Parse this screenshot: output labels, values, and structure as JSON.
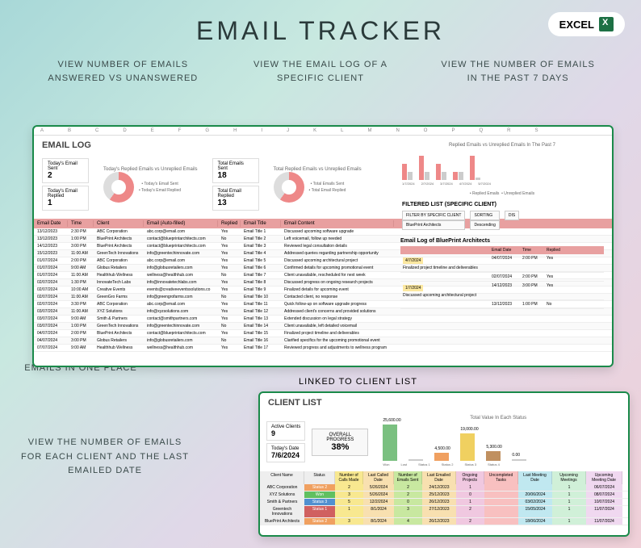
{
  "title": "EMAIL TRACKER",
  "excelBadge": "EXCEL",
  "callouts": {
    "top1": "VIEW NUMBER OF EMAILS ANSWERED VS UNANSWERED",
    "top2": "VIEW THE EMAIL LOG OF A SPECIFIC CLIENT",
    "top3": "VIEW THE NUMBER OF EMAILS IN THE PAST 7 DAYS",
    "left1": "RECORD ALL YOUR EMAILS IN ONE PLACE",
    "left2": "VIEW THE NUMBER OF EMAILS FOR EACH CLIENT AND THE LAST EMAILED DATE",
    "link": "LINKED TO CLIENT LIST"
  },
  "panel1": {
    "title": "EMAIL LOG",
    "stats": {
      "s1l": "Today's Email Sent",
      "s1v": "2",
      "s2l": "Today's Email Replied",
      "s2v": "1",
      "s3l": "Total Emails Sent",
      "s3v": "18",
      "s4l": "Total Email Replied",
      "s4v": "13"
    },
    "legend1a": "• Today's Email Sent",
    "legend1b": "• Today's Email Replied",
    "legend2a": "• Total Emails Sent",
    "legend2b": "• Total Email Replied",
    "chartTitle1": "Today's Replied Emails vs Unreplied Emails",
    "chartTitle2": "Total Replied Emails vs Unreplied Emails",
    "headers": [
      "Email Date",
      "Time",
      "Client",
      "Email (Auto-filled)",
      "Replied",
      "Email Title",
      "Email Content"
    ],
    "rows": [
      [
        "13/12/2023",
        "2:30 PM",
        "ABC Corporation",
        "abc.corp@email.com",
        "Yes",
        "Email Title 1",
        "Discussed upcoming software upgrade"
      ],
      [
        "13/12/2023",
        "1:00 PM",
        "BluePrint Architects",
        "contact@blueprintarchitects.com",
        "No",
        "Email Title 2",
        "Left voicemail, follow up needed"
      ],
      [
        "14/12/2023",
        "3:00 PM",
        "BluePrint Architects",
        "contact@blueprintarchitects.com",
        "Yes",
        "Email Title 3",
        "Reviewed legal consultation details"
      ],
      [
        "15/12/2023",
        "11:00 AM",
        "GreenTech Innovations",
        "info@greentechinnovate.com",
        "Yes",
        "Email Title 4",
        "Addressed queries regarding partnership opportunity"
      ],
      [
        "01/07/2024",
        "2:00 PM",
        "ABC Corporation",
        "abc.corp@email.com",
        "Yes",
        "Email Title 5",
        "Discussed upcoming architectural project"
      ],
      [
        "01/07/2024",
        "9:00 AM",
        "Globus Retailers",
        "info@globusretailers.com",
        "Yes",
        "Email Title 6",
        "Confirmed details for upcoming promotional event"
      ],
      [
        "01/07/2024",
        "11:00 AM",
        "Healthhub Wellness",
        "wellness@healthhub.com",
        "No",
        "Email Title 7",
        "Client unavailable, rescheduled for next week"
      ],
      [
        "02/07/2024",
        "1:30 PM",
        "InnovateTech Labs",
        "info@innovatetechlabs.com",
        "Yes",
        "Email Title 8",
        "Discussed progress on ongoing research projects"
      ],
      [
        "02/07/2024",
        "10:00 AM",
        "Creative Events",
        "events@creativeeventssolutions.co",
        "Yes",
        "Email Title 9",
        "Finalized details for upcoming event"
      ],
      [
        "02/07/2024",
        "11:00 AM",
        "GreenGro Farms",
        "info@greengrofarms.com",
        "No",
        "Email Title 10",
        "Contacted client, no response"
      ],
      [
        "02/07/2024",
        "3:30 PM",
        "ABC Corporation",
        "abc.corp@email.com",
        "Yes",
        "Email Title 11",
        "Quick follow-up on software upgrade progress"
      ],
      [
        "03/07/2024",
        "11:00 AM",
        "XYZ Solutions",
        "info@xyzsolutions.com",
        "Yes",
        "Email Title 12",
        "Addressed client's concerns and provided solutions"
      ],
      [
        "03/07/2024",
        "9:00 AM",
        "Smith & Partners",
        "contact@smithpartners.com",
        "Yes",
        "Email Title 13",
        "Extended discussion on legal strategy"
      ],
      [
        "03/07/2024",
        "1:00 PM",
        "GreenTech Innovations",
        "info@greentechinnovate.com",
        "No",
        "Email Title 14",
        "Client unavailable, left detailed voicemail"
      ],
      [
        "04/07/2024",
        "2:00 PM",
        "BluePrint Architects",
        "contact@blueprintarchitects.com",
        "Yes",
        "Email Title 15",
        "Finalized project timeline and deliverables"
      ],
      [
        "04/07/2024",
        "3:00 PM",
        "Globus Retailers",
        "info@globusretailers.com",
        "No",
        "Email Title 16",
        "Clarified specifics for the upcoming promotional event"
      ],
      [
        "07/07/2024",
        "9:00 AM",
        "Healthhub Wellness",
        "wellness@healthhub.com",
        "Yes",
        "Email Title 17",
        "Reviewed progress and adjustments to wellness program"
      ]
    ]
  },
  "rightChart": {
    "title": "Replied Emails vs Unreplied Emails In The Past 7",
    "legend1": "• Replied Emails",
    "legend2": "• Unreplied Emails",
    "dates": [
      "1/7/2024",
      "2/7/2024",
      "3/7/2024",
      "4/7/2024",
      "5/7/2024"
    ]
  },
  "filtered": {
    "title": "FILTERED LIST (SPECIFIC CLIENT)",
    "f1l": "FILTER BY SPECIFIC CLIENT",
    "f1v": "BluePrint Architects",
    "f2l": "SORTING",
    "f2v": "Descending",
    "f3l": "DIS",
    "logTitle": "Email Log of BluePrint Architects",
    "headers": [
      "",
      "Email Date",
      "Time",
      "Replied"
    ],
    "d1": "4/7/2024",
    "d2": "1/7/2024",
    "r1desc": "Finalized project timeline and deliverables",
    "r2desc": "Discussed upcoming architectural project",
    "rows": [
      [
        "04/07/2024",
        "2:00 PM",
        "Yes"
      ],
      [
        "02/07/2024",
        "2:00 PM",
        "Yes"
      ],
      [
        "14/12/2023",
        "3:00 PM",
        "Yes"
      ],
      [
        "13/12/2023",
        "1:00 PM",
        "No"
      ]
    ]
  },
  "panel2": {
    "title": "CLIENT LIST",
    "s1l": "Active Clients",
    "s1v": "9",
    "s2l": "Today's Date",
    "s2v": "7/6/2024",
    "pl": "OVERALL PROGRESS",
    "pv": "38%",
    "chartTitle": "Total Value In Each Status",
    "headers": [
      "Client Name",
      "Status",
      "Number of Calls Made",
      "Last Called Date",
      "Number of Emails Sent",
      "Last Emailed Date",
      "Ongoing Projects",
      "Uncompleted Tasks",
      "Last Meeting Date",
      "Upcoming Meetings",
      "Upcoming Meeting Date"
    ],
    "rows": [
      [
        "ABC Corporation",
        "Status 2",
        "2",
        "5/26/2024",
        "2",
        "24/12/2023",
        "1",
        "",
        "",
        "1",
        "06/07/2024"
      ],
      [
        "XYZ Solutions",
        "Won",
        "3",
        "5/26/2024",
        "2",
        "25/12/2023",
        "0",
        "",
        "20/06/2024",
        "1",
        "08/07/2024"
      ],
      [
        "Smith & Partners",
        "Status 3",
        "5",
        "12/2/2024",
        "0",
        "26/12/2023",
        "1",
        "",
        "03/02/2024",
        "1",
        "10/07/2024"
      ],
      [
        "Greentech Innovations",
        "Status 1",
        "1",
        "8/1/2024",
        "3",
        "27/12/2023",
        "2",
        "",
        "15/05/2024",
        "1",
        "11/07/2024"
      ],
      [
        "BluePrint Architects",
        "Status 2",
        "3",
        "8/1/2024",
        "4",
        "26/12/2023",
        "2",
        "",
        "18/06/2024",
        "1",
        "11/07/2024"
      ]
    ]
  },
  "chart_data": [
    {
      "type": "bar",
      "title": "Replied vs Unreplied Past 7 Days",
      "categories": [
        "1/7/2024",
        "2/7/2024",
        "3/7/2024",
        "4/7/2024",
        "5/7/2024"
      ],
      "series": [
        {
          "name": "Replied",
          "values": [
            2,
            3,
            2,
            1,
            3
          ]
        },
        {
          "name": "Unreplied",
          "values": [
            1,
            1,
            1,
            1,
            0
          ]
        }
      ]
    },
    {
      "type": "pie",
      "title": "Today's Replied vs Unreplied",
      "series": [
        {
          "name": "Sent",
          "value": 2
        },
        {
          "name": "Replied",
          "value": 1
        }
      ]
    },
    {
      "type": "pie",
      "title": "Total Replied vs Unreplied",
      "series": [
        {
          "name": "Sent",
          "value": 18
        },
        {
          "name": "Replied",
          "value": 13
        }
      ]
    },
    {
      "type": "bar",
      "title": "Total Value In Each Status",
      "categories": [
        "Won",
        "Lost",
        "Status 1",
        "Status 2",
        "Status 3",
        "Status 4"
      ],
      "values": [
        25600,
        0,
        4500,
        19000,
        5300,
        0
      ],
      "ylim": [
        0,
        30000
      ]
    }
  ]
}
